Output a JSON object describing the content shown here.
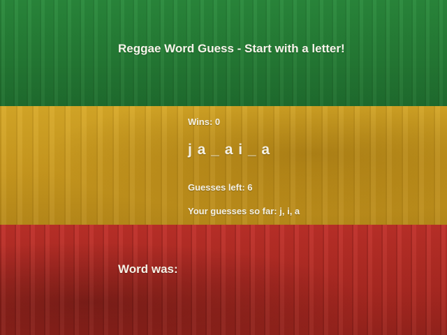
{
  "page": {
    "title": "Reggae Word Guess - Start with a letter!"
  },
  "stats": {
    "wins_label": "Wins: 0",
    "word": "j a _ a i _ a",
    "guesses_left_label": "Guesses left: 6",
    "guesses_so_far_label": "Your guesses so far: j, i, a",
    "word_was_label": "Word was:"
  },
  "colors": {
    "band_green": "#247a34",
    "band_yellow": "#c9991f",
    "band_red": "#ad2a22",
    "text": "#f4f1e6"
  }
}
